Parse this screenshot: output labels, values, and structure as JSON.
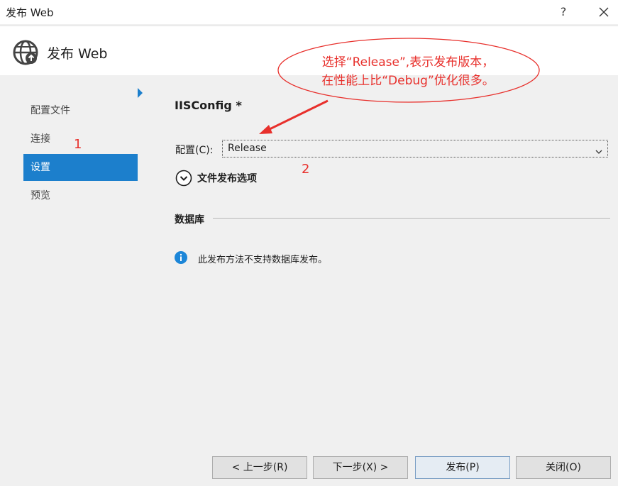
{
  "window": {
    "title": "发布 Web",
    "help_label": "?"
  },
  "header": {
    "title": "发布 Web"
  },
  "sidebar": {
    "items": [
      {
        "label": "配置文件"
      },
      {
        "label": "连接"
      },
      {
        "label": "设置",
        "active": true
      },
      {
        "label": "预览"
      }
    ]
  },
  "annotations": {
    "marker1": "1",
    "marker2": "2",
    "callout_line1": "选择“Release”,表示发布版本，",
    "callout_line2": "在性能上比“Debug”优化很多。",
    "color": "#e8302c"
  },
  "main": {
    "profile_name": "IISConfig *",
    "config_label": "配置(C):",
    "config_value": "Release",
    "file_publish_options": "文件发布选项",
    "database_heading": "数据库",
    "info_message": "此发布方法不支持数据库发布。"
  },
  "buttons": {
    "prev": "< 上一步(R)",
    "next": "下一步(X) >",
    "publish": "发布(P)",
    "close": "关闭(O)"
  },
  "colors": {
    "accent": "#1c7fcc",
    "background": "#f0f0f0",
    "annotation": "#e8302c"
  }
}
